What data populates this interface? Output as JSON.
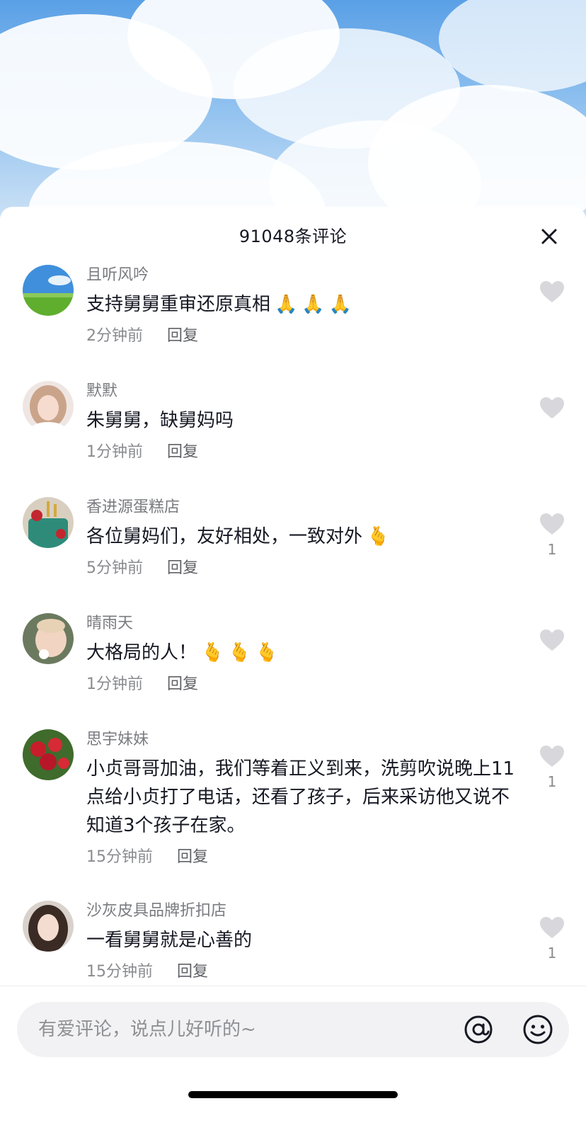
{
  "header": {
    "title": "91048条评论",
    "close_icon": "close-icon"
  },
  "comments": [
    {
      "avatar": "landscape-avatar",
      "username": "且听风吟",
      "text": "支持舅舅重审还原真相",
      "emojis": [
        "🙏",
        "🙏",
        "🙏"
      ],
      "time": "2分钟前",
      "reply": "回复",
      "likes": ""
    },
    {
      "avatar": "girl-avatar",
      "username": "默默",
      "text": "朱舅舅，缺舅妈吗",
      "emojis": [],
      "time": "1分钟前",
      "reply": "回复",
      "likes": ""
    },
    {
      "avatar": "cake-avatar",
      "username": "香进源蛋糕店",
      "text": "各位舅妈们，友好相处，一致对外",
      "emojis": [
        "🫰"
      ],
      "time": "5分钟前",
      "reply": "回复",
      "likes": "1"
    },
    {
      "avatar": "baby-avatar",
      "username": "晴雨天",
      "text": "大格局的人！",
      "emojis": [
        "🫰",
        "🫰",
        "🫰"
      ],
      "time": "1分钟前",
      "reply": "回复",
      "likes": ""
    },
    {
      "avatar": "roses-avatar",
      "username": "思宇妹妹",
      "text": "小贞哥哥加油，我们等着正义到来，洗剪吹说晚上11点给小贞打了电话，还看了孩子，后来采访他又说不知道3个孩子在家。",
      "emojis": [],
      "time": "15分钟前",
      "reply": "回复",
      "likes": "1"
    },
    {
      "avatar": "woman-avatar",
      "username": "沙灰皮具品牌折扣店",
      "text": "一看舅舅就是心善的",
      "emojis": [],
      "time": "15分钟前",
      "reply": "回复",
      "likes": "1"
    }
  ],
  "footer": {
    "placeholder": "有爱评论，说点儿好听的~",
    "at_icon": "at-icon",
    "emoji_icon": "smile-icon"
  },
  "colors": {
    "text_primary": "#161823",
    "text_secondary": "#8a8b8f",
    "like_icon": "#d8d8dc",
    "input_bg": "#f2f2f4"
  }
}
